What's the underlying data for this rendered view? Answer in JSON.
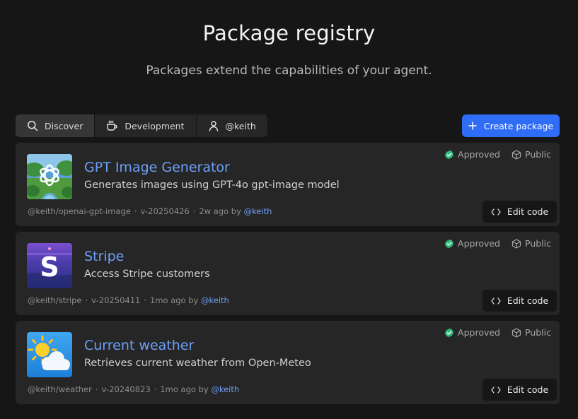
{
  "header": {
    "title": "Package registry",
    "subtitle": "Packages extend the capabilities of your agent."
  },
  "tabs": [
    {
      "label": "Discover",
      "icon": "search-icon",
      "active": true
    },
    {
      "label": "Development",
      "icon": "coffee-cup-icon",
      "active": false
    },
    {
      "label": "@keith",
      "icon": "user-icon",
      "active": false
    }
  ],
  "create_button": {
    "label": "Create package",
    "icon": "plus-icon"
  },
  "packages": [
    {
      "name": "GPT Image Generator",
      "description": "Generates images using GPT-4o gpt-image model",
      "slug": "@keith/openai-gpt-image",
      "version": "v-20250426",
      "updated": "2w ago by",
      "author": "@keith",
      "status": "Approved",
      "visibility": "Public",
      "edit_label": "Edit code",
      "thumbnail": "openai-logo-landscape"
    },
    {
      "name": "Stripe",
      "description": "Access Stripe customers",
      "slug": "@keith/stripe",
      "version": "v-20250411",
      "updated": "1mo ago by",
      "author": "@keith",
      "status": "Approved",
      "visibility": "Public",
      "edit_label": "Edit code",
      "thumbnail": "stripe-s-logo"
    },
    {
      "name": "Current weather",
      "description": "Retrieves current weather from Open-Meteo",
      "slug": "@keith/weather",
      "version": "v-20240823",
      "updated": "1mo ago by",
      "author": "@keith",
      "status": "Approved",
      "visibility": "Public",
      "edit_label": "Edit code",
      "thumbnail": "sun-cloud-icon"
    }
  ],
  "colors": {
    "background": "#161616",
    "card": "#262626",
    "accent": "#2f6df6",
    "link": "#6ea0f7",
    "approved": "#2fbf7a"
  }
}
